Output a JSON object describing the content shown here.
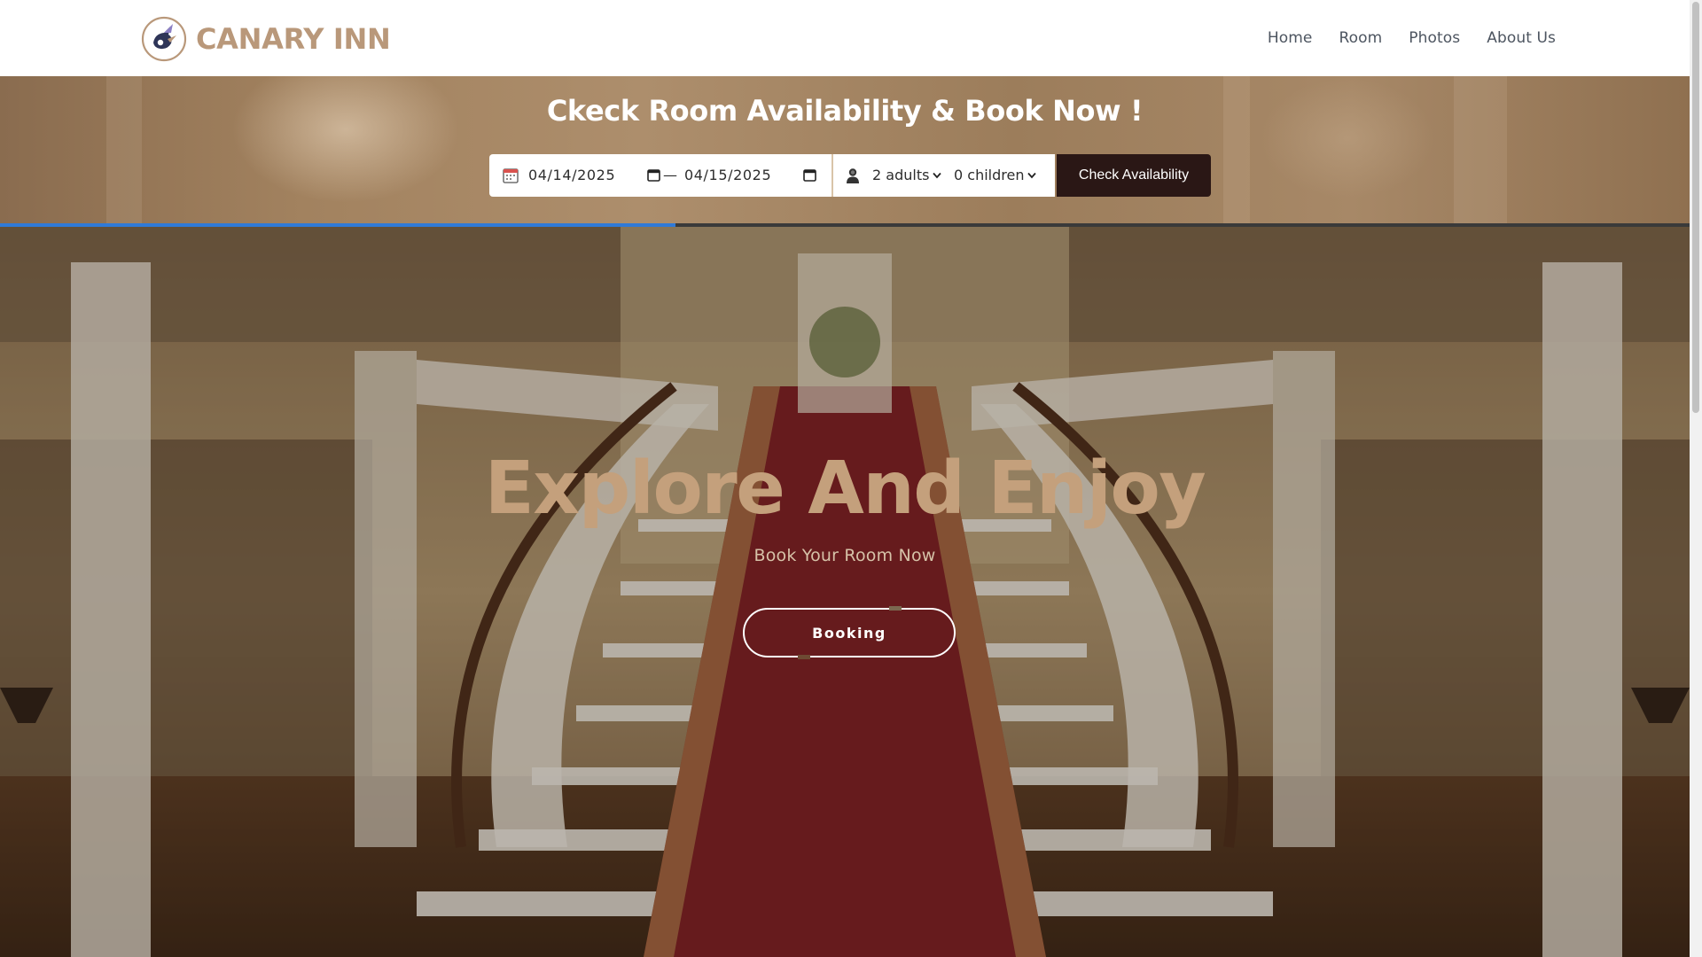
{
  "brand": {
    "name": "CANARY INN",
    "accent": "#b9987a"
  },
  "nav": {
    "items": [
      {
        "label": "Home"
      },
      {
        "label": "Room"
      },
      {
        "label": "Photos"
      },
      {
        "label": "About Us"
      }
    ]
  },
  "booking": {
    "title": "Ckeck Room Availability & Book Now !",
    "check_in": "04/14/2025",
    "separator": "—",
    "check_out": "04/15/2025",
    "adults": "2 adults",
    "children": "0 children",
    "button_label": "Check Availability",
    "button_color": "#2a1715"
  },
  "progress": {
    "value": 0.4
  },
  "hero": {
    "title": "Explore And Enjoy",
    "subtitle": "Book Your Room Now",
    "button_label": "Booking",
    "title_color": "#c4a07c"
  },
  "icons": {
    "logo": "canary-inn-logo-icon",
    "check_in": "calendar-icon",
    "date_picker": "calendar-icon",
    "guests": "person-icon",
    "dropdown": "chevron-down-icon"
  }
}
